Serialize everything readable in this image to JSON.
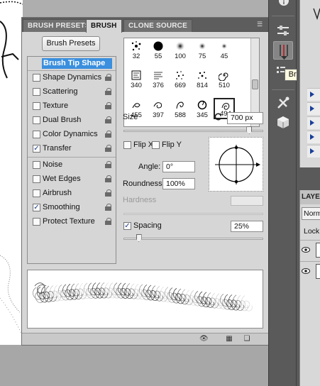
{
  "tabs": [
    {
      "label": "BRUSH PRESETS",
      "active": false
    },
    {
      "label": "BRUSH",
      "active": true
    },
    {
      "label": "CLONE SOURCE",
      "active": false
    }
  ],
  "brush_presets_button": "Brush Presets",
  "options": [
    {
      "label": "Brush Tip Shape",
      "checkbox": false,
      "checked": false,
      "lock": false,
      "selected": true
    },
    {
      "label": "Shape Dynamics",
      "checkbox": true,
      "checked": false,
      "lock": true
    },
    {
      "label": "Scattering",
      "checkbox": true,
      "checked": false,
      "lock": true
    },
    {
      "label": "Texture",
      "checkbox": true,
      "checked": false,
      "lock": true
    },
    {
      "label": "Dual Brush",
      "checkbox": true,
      "checked": false,
      "lock": true
    },
    {
      "label": "Color Dynamics",
      "checkbox": true,
      "checked": false,
      "lock": true
    },
    {
      "label": "Transfer",
      "checkbox": true,
      "checked": true,
      "lock": true
    },
    {
      "label": "Noise",
      "checkbox": true,
      "checked": false,
      "lock": true
    },
    {
      "label": "Wet Edges",
      "checkbox": true,
      "checked": false,
      "lock": true
    },
    {
      "label": "Airbrush",
      "checkbox": true,
      "checked": false,
      "lock": true
    },
    {
      "label": "Smoothing",
      "checkbox": true,
      "checked": true,
      "lock": true
    },
    {
      "label": "Protect Texture",
      "checkbox": true,
      "checked": false,
      "lock": true
    }
  ],
  "brush_tips": [
    {
      "size": "32",
      "shape": "splatter"
    },
    {
      "size": "55",
      "shape": "hard-round"
    },
    {
      "size": "100",
      "shape": "soft-round"
    },
    {
      "size": "75",
      "shape": "soft-round"
    },
    {
      "size": "45",
      "shape": "soft-round"
    },
    {
      "size": "340",
      "shape": "sketch"
    },
    {
      "size": "376",
      "shape": "text"
    },
    {
      "size": "669",
      "shape": "scatter"
    },
    {
      "size": "814",
      "shape": "scatter"
    },
    {
      "size": "510",
      "shape": "swirl"
    },
    {
      "size": "455",
      "shape": "swirl"
    },
    {
      "size": "397",
      "shape": "swirl"
    },
    {
      "size": "588",
      "shape": "swirl"
    },
    {
      "size": "345",
      "shape": "swirl"
    },
    {
      "size": "494",
      "shape": "swirl",
      "selected": true
    }
  ],
  "size": {
    "label": "Size",
    "value": "700 px",
    "slider_fraction": 0.9
  },
  "flip_x": {
    "label": "Flip X",
    "checked": false
  },
  "flip_y": {
    "label": "Flip Y",
    "checked": false
  },
  "angle": {
    "label": "Angle:",
    "value": "0°"
  },
  "roundness": {
    "label": "Roundness:",
    "value": "100%"
  },
  "hardness": {
    "label": "Hardness",
    "value": ""
  },
  "spacing": {
    "label": "Spacing",
    "checked": true,
    "value": "25%",
    "slider_fraction": 0.11
  },
  "tooltip": "Brush",
  "layers_panel": {
    "tab_label": "LAYER",
    "blend_mode": "Norma",
    "lock_label": "Lock:"
  },
  "colors": {
    "selection_blue": "#3a8fde",
    "panel_bg": "#d6d6d6",
    "tool_strip": "#5a5a5a",
    "tooltip_bg": "#fffbe1"
  }
}
